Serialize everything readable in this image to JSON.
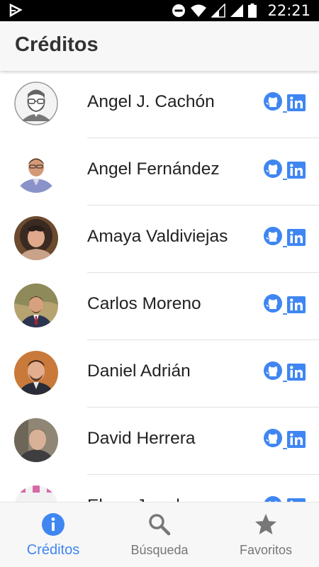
{
  "status_bar": {
    "time": "22:21"
  },
  "app_bar": {
    "title": "Créditos"
  },
  "credits": [
    {
      "name": "Angel J. Cachón",
      "avatar": "illustrated-bearded-man-avatar"
    },
    {
      "name": "Angel Fernández",
      "avatar": "photo"
    },
    {
      "name": "Amaya Valdiviejas",
      "avatar": "photo"
    },
    {
      "name": "Carlos Moreno",
      "avatar": "photo"
    },
    {
      "name": "Daniel Adrián",
      "avatar": "photo"
    },
    {
      "name": "David Herrera",
      "avatar": "photo"
    },
    {
      "name": "Elena Jurado",
      "avatar": "photo"
    }
  ],
  "links": {
    "github_icon": "github-icon",
    "linkedin_icon": "linkedin-icon",
    "color": "#3f86f2"
  },
  "bottom_nav": {
    "items": [
      {
        "label": "Créditos",
        "icon": "info-icon",
        "active": true
      },
      {
        "label": "Búsqueda",
        "icon": "search-icon",
        "active": false
      },
      {
        "label": "Favoritos",
        "icon": "star-icon",
        "active": false
      }
    ],
    "active_color": "#3f86f2",
    "inactive_color": "#777777"
  }
}
